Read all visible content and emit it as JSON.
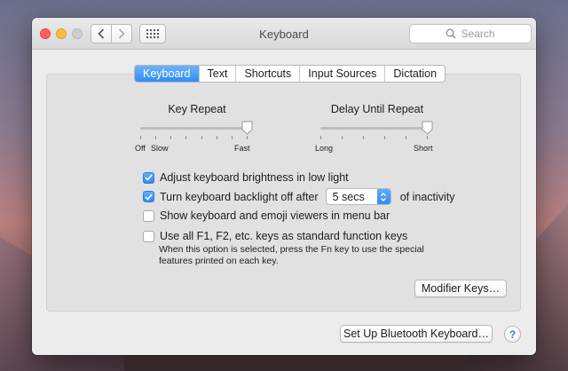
{
  "window": {
    "title": "Keyboard"
  },
  "toolbar": {
    "search_placeholder": "Search"
  },
  "tabs": [
    {
      "label": "Keyboard",
      "active": true
    },
    {
      "label": "Text",
      "active": false
    },
    {
      "label": "Shortcuts",
      "active": false
    },
    {
      "label": "Input Sources",
      "active": false
    },
    {
      "label": "Dictation",
      "active": false
    }
  ],
  "key_repeat": {
    "title": "Key Repeat",
    "labels": {
      "off": "Off",
      "slow": "Slow",
      "fast": "Fast"
    },
    "value": 1.0
  },
  "delay_until_repeat": {
    "title": "Delay Until Repeat",
    "labels": {
      "long": "Long",
      "short": "Short"
    },
    "value": 1.0
  },
  "options": [
    {
      "label": "Adjust keyboard brightness in low light",
      "checked": true
    },
    {
      "label": "Turn keyboard backlight off after",
      "checked": true,
      "select_value": "5 secs",
      "suffix": "of inactivity"
    },
    {
      "label": "Show keyboard and emoji viewers in menu bar",
      "checked": false
    },
    {
      "label": "Use all F1, F2, etc. keys as standard function keys",
      "checked": false
    }
  ],
  "note": "When this option is selected, press the Fn key to use the special features printed on each key.",
  "buttons": {
    "modifier_keys": "Modifier Keys…",
    "bluetooth": "Set Up Bluetooth Keyboard…",
    "help": "?"
  },
  "colors": {
    "accent": "#2f8cf3",
    "close": "#fc605c",
    "minimize": "#fdbc40"
  }
}
